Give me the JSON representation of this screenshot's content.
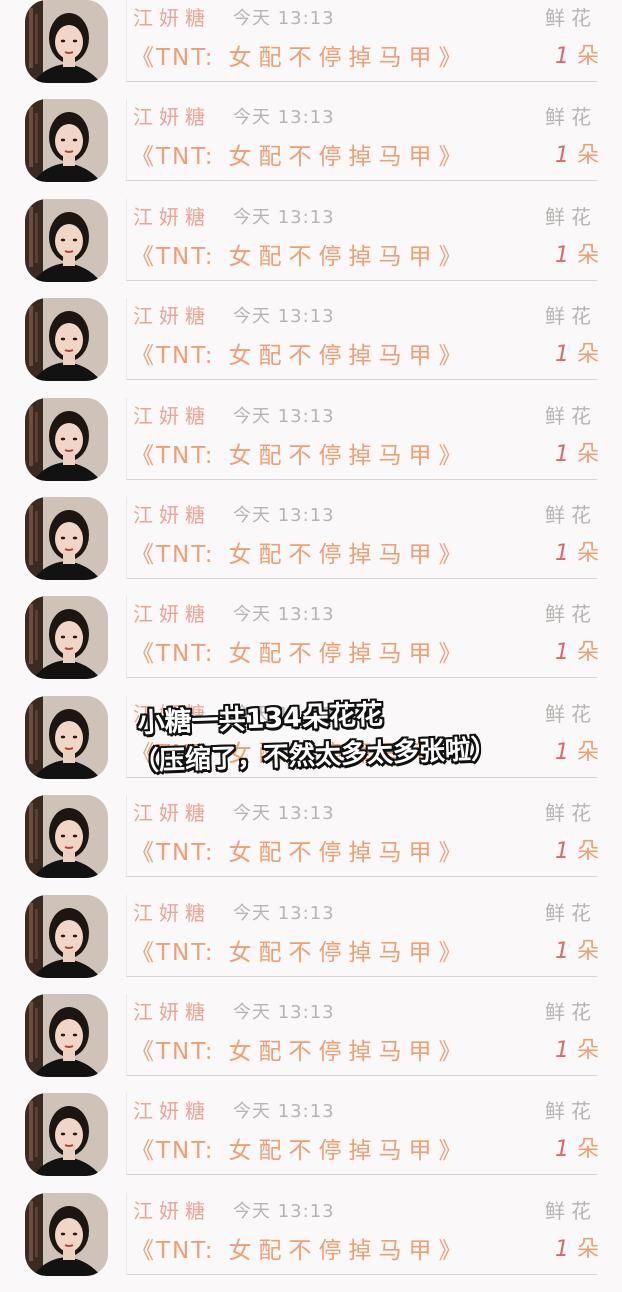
{
  "records": [
    {
      "name": "江妍糖",
      "time": "今天 13:13",
      "gift": "鲜花",
      "book_title": "《TNT:",
      "book_subtitle": "女配不停掉马甲》",
      "count": "1",
      "unit": "朵"
    },
    {
      "name": "江妍糖",
      "time": "今天 13:13",
      "gift": "鲜花",
      "book_title": "《TNT:",
      "book_subtitle": "女配不停掉马甲》",
      "count": "1",
      "unit": "朵"
    },
    {
      "name": "江妍糖",
      "time": "今天 13:13",
      "gift": "鲜花",
      "book_title": "《TNT:",
      "book_subtitle": "女配不停掉马甲》",
      "count": "1",
      "unit": "朵"
    },
    {
      "name": "江妍糖",
      "time": "今天 13:13",
      "gift": "鲜花",
      "book_title": "《TNT:",
      "book_subtitle": "女配不停掉马甲》",
      "count": "1",
      "unit": "朵"
    },
    {
      "name": "江妍糖",
      "time": "今天 13:13",
      "gift": "鲜花",
      "book_title": "《TNT:",
      "book_subtitle": "女配不停掉马甲》",
      "count": "1",
      "unit": "朵"
    },
    {
      "name": "江妍糖",
      "time": "今天 13:13",
      "gift": "鲜花",
      "book_title": "《TNT:",
      "book_subtitle": "女配不停掉马甲》",
      "count": "1",
      "unit": "朵"
    },
    {
      "name": "江妍糖",
      "time": "今天 13:13",
      "gift": "鲜花",
      "book_title": "《TNT:",
      "book_subtitle": "女配不停掉马甲》",
      "count": "1",
      "unit": "朵"
    },
    {
      "name": "江妍糖",
      "time": "今天 13:13",
      "gift": "鲜花",
      "book_title": "《TNT:",
      "book_subtitle": "女配不停掉马甲》",
      "count": "1",
      "unit": "朵"
    },
    {
      "name": "江妍糖",
      "time": "今天 13:13",
      "gift": "鲜花",
      "book_title": "《TNT:",
      "book_subtitle": "女配不停掉马甲》",
      "count": "1",
      "unit": "朵"
    },
    {
      "name": "江妍糖",
      "time": "今天 13:13",
      "gift": "鲜花",
      "book_title": "《TNT:",
      "book_subtitle": "女配不停掉马甲》",
      "count": "1",
      "unit": "朵"
    },
    {
      "name": "江妍糖",
      "time": "今天 13:13",
      "gift": "鲜花",
      "book_title": "《TNT:",
      "book_subtitle": "女配不停掉马甲》",
      "count": "1",
      "unit": "朵"
    },
    {
      "name": "江妍糖",
      "time": "今天 13:13",
      "gift": "鲜花",
      "book_title": "《TNT:",
      "book_subtitle": "女配不停掉马甲》",
      "count": "1",
      "unit": "朵"
    },
    {
      "name": "江妍糖",
      "time": "今天 13:13",
      "gift": "鲜花",
      "book_title": "《TNT:",
      "book_subtitle": "女配不停掉马甲》",
      "count": "1",
      "unit": "朵"
    }
  ],
  "overlay": {
    "line1": "小糖一共134朵花花",
    "line2": "（压缩了，不然太多太多张啦）"
  },
  "colors": {
    "name": "#eba595",
    "book": "#f09f74",
    "count": "#e06767",
    "muted": "#b9b4b4",
    "divider": "#d9d4d4"
  },
  "icons": {
    "avatar": "user-photo-avatar"
  }
}
